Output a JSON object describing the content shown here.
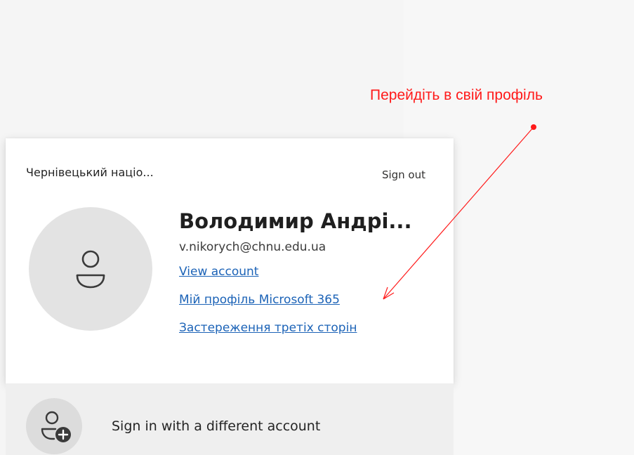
{
  "account": {
    "org_name": "Чернівецький націо...",
    "sign_out_label": "Sign out",
    "display_name": "Володимир Андрі...",
    "email": "v.nikorych@chnu.edu.ua",
    "links": {
      "view_account": "View account",
      "my_profile": "Мій профіль Microsoft 365",
      "third_party": "Застереження третіх сторін"
    }
  },
  "other_account": {
    "label": "Sign in with a different account"
  },
  "annotation": {
    "text": "Перейдіть в свій профіль",
    "color": "#ff1a1a"
  },
  "colors": {
    "link": "#1c63b7",
    "card_bg": "#ffffff",
    "page_bg": "#f5f5f5"
  },
  "icons": {
    "avatar": "person-icon",
    "add_account": "person-add-icon"
  }
}
